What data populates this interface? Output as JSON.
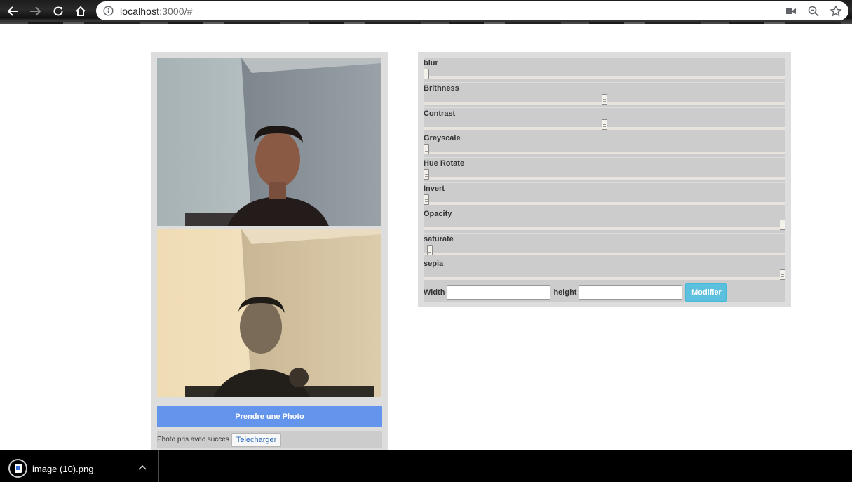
{
  "browser": {
    "url_host": "localhost",
    "url_rest": ":3000/#",
    "icons": [
      "back-arrow-icon",
      "forward-arrow-icon",
      "reload-icon",
      "home-icon",
      "info-icon",
      "camera-icon",
      "zoom-out-icon",
      "star-icon"
    ]
  },
  "camera": {
    "take_photo_label": "Prendre une Photo",
    "status_text": "Photo pris avec succes",
    "download_label": "Telecharger"
  },
  "filters": [
    {
      "label": "blur",
      "value": 0.0
    },
    {
      "label": "Brithness",
      "value": 0.5
    },
    {
      "label": "Contrast",
      "value": 0.5
    },
    {
      "label": "Greyscale",
      "value": 0.0
    },
    {
      "label": "Hue Rotate",
      "value": 0.0
    },
    {
      "label": "Invert",
      "value": 0.0
    },
    {
      "label": "Opacity",
      "value": 1.0
    },
    {
      "label": "saturate",
      "value": 0.01
    },
    {
      "label": "sepia",
      "value": 1.0
    }
  ],
  "size": {
    "width_label": "Width",
    "height_label": "height",
    "width_value": "",
    "height_value": "",
    "modify_label": "Modifier"
  },
  "downloads": {
    "file_name": "image (10).png"
  },
  "colors": {
    "take_photo_button": "#6495ed",
    "modify_button": "#5bc0de",
    "panel_bg": "#dddddd",
    "row_bg": "#cccccc"
  }
}
